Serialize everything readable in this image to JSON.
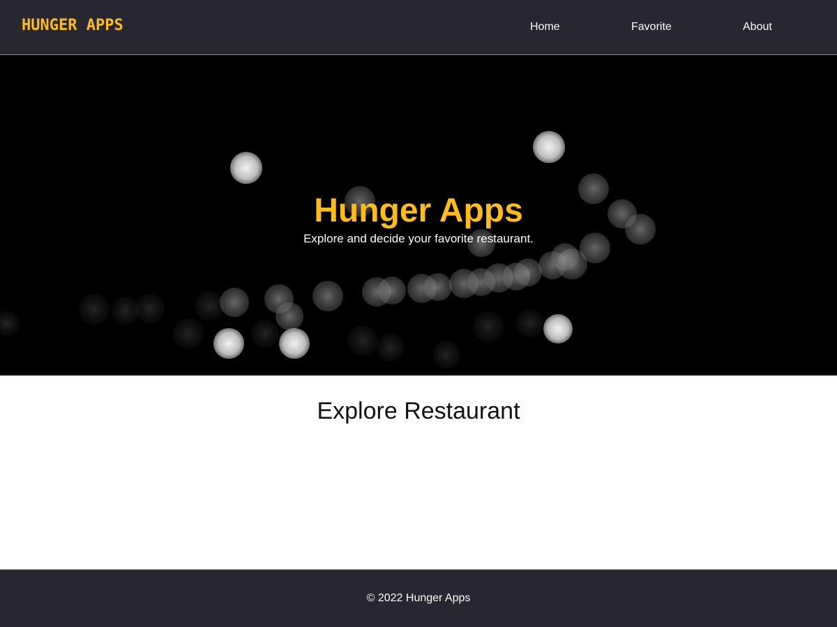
{
  "header": {
    "brand": "HUNGER APPS",
    "nav": [
      {
        "label": "Home"
      },
      {
        "label": "Favorite"
      },
      {
        "label": "About"
      }
    ]
  },
  "hero": {
    "title": "Hunger Apps",
    "subtitle": "Explore and decide your favorite restaurant."
  },
  "main": {
    "title": "Explore Restaurant"
  },
  "footer": {
    "text": "© 2022 Hunger Apps"
  },
  "colors": {
    "accent": "#ffbc16",
    "bar": "#262730",
    "hero_bg": "#000000"
  }
}
